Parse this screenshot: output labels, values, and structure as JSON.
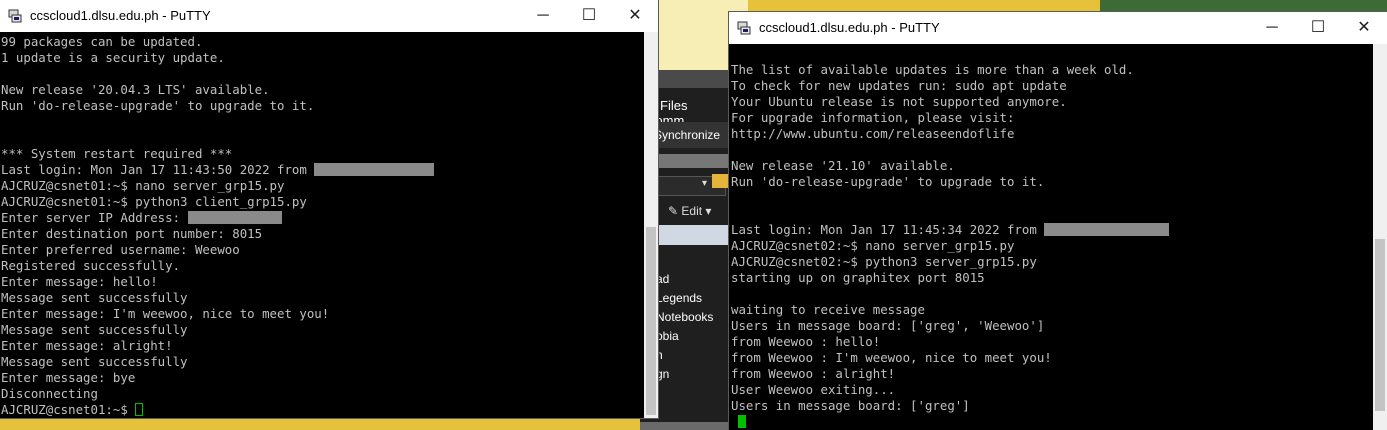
{
  "left_window": {
    "title": "ccscloud1.dlsu.edu.ph - PuTTY",
    "minimize": "─",
    "maximize": "☐",
    "close": "✕",
    "lines": [
      "99 packages can be updated.",
      "1 update is a security update.",
      "",
      "New release '20.04.3 LTS' available.",
      "Run 'do-release-upgrade' to upgrade to it.",
      "",
      "",
      "*** System restart required ***",
      "Last login: Mon Jan 17 11:43:50 2022 from ",
      "AJCRUZ@csnet01:~$ nano server_grp15.py",
      "AJCRUZ@csnet01:~$ python3 client_grp15.py",
      "Enter server IP Address: ",
      "Enter destination port number: 8015",
      "Enter preferred username: Weewoo",
      "Registered successfully.",
      "Enter message: hello!",
      "Message sent successfully",
      "Enter message: I'm weewoo, nice to meet you!",
      "Message sent successfully",
      "Enter message: alright!",
      "Message sent successfully",
      "Enter message: bye",
      "Disconnecting",
      "AJCRUZ@csnet01:~$ "
    ]
  },
  "right_window": {
    "title": "ccscloud1.dlsu.edu.ph - PuTTY",
    "minimize": "─",
    "maximize": "☐",
    "close": "✕",
    "lines": [
      "The list of available updates is more than a week old.",
      "To check for new updates run: sudo apt update",
      "Your Ubuntu release is not supported anymore.",
      "For upgrade information, please visit:",
      "http://www.ubuntu.com/releaseendoflife",
      "",
      "New release '21.10' available.",
      "Run 'do-release-upgrade' to upgrade to it.",
      "",
      "",
      "Last login: Mon Jan 17 11:45:34 2022 from ",
      "AJCRUZ@csnet02:~$ nano server_grp15.py",
      "AJCRUZ@csnet02:~$ python3 server_grp15.py",
      "starting up on graphitex port 8015",
      "",
      "waiting to receive message",
      "Users in message board: ['greg', 'Weewoo']",
      "from Weewoo : hello!",
      "from Weewoo : I'm weewoo, nice to meet you!",
      "from Weewoo : alright!",
      "User Weewoo exiting...",
      "Users in message board: ['greg']",
      ""
    ]
  },
  "background_app": {
    "menu_files": "Files",
    "menu_comm": "Comm",
    "synchronize": "Synchronize",
    "edit": "Edit",
    "list": [
      "ad",
      "",
      "Legends",
      "Notebooks",
      "obia",
      "",
      "n",
      "gn"
    ]
  },
  "colors": {
    "terminal_bg": "#000000",
    "terminal_fg": "#c0c0c0",
    "cursor": "#00c000",
    "redaction": "#8a8a8a"
  }
}
